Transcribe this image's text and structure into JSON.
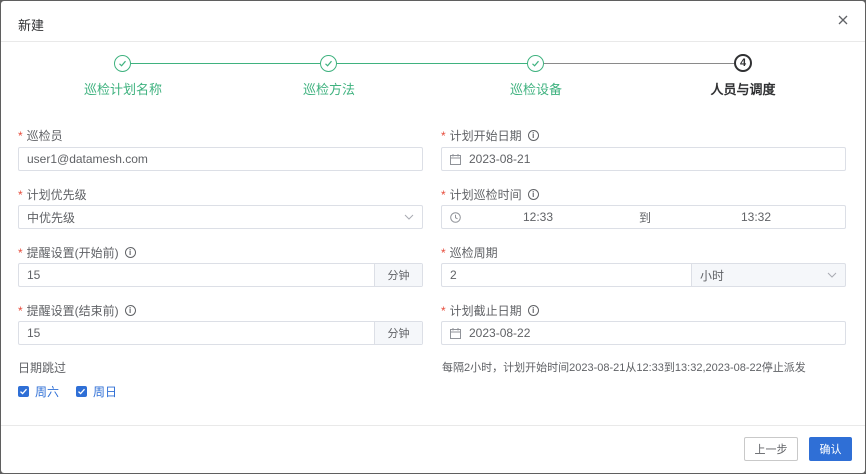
{
  "dialog": {
    "title": "新建"
  },
  "steps": [
    {
      "label": "巡检计划名称",
      "status": "done"
    },
    {
      "label": "巡检方法",
      "status": "done"
    },
    {
      "label": "巡检设备",
      "status": "done"
    },
    {
      "label": "人员与调度",
      "status": "active",
      "number": "4"
    }
  ],
  "form": {
    "inspector": {
      "label": "巡检员",
      "value": "user1@datamesh.com"
    },
    "start_date": {
      "label": "计划开始日期",
      "value": "2023-08-21"
    },
    "priority": {
      "label": "计划优先级",
      "value": "中优先级"
    },
    "time": {
      "label": "计划巡检时间",
      "start": "12:33",
      "sep": "到",
      "end": "13:32"
    },
    "remind_start": {
      "label": "提醒设置(开始前)",
      "value": "15",
      "unit": "分钟"
    },
    "period": {
      "label": "巡检周期",
      "value": "2",
      "unit": "小时"
    },
    "remind_end": {
      "label": "提醒设置(结束前)",
      "value": "15",
      "unit": "分钟"
    },
    "end_date": {
      "label": "计划截止日期",
      "value": "2023-08-22"
    },
    "skip": {
      "label": "日期跳过",
      "options": [
        "周六",
        "周日"
      ]
    },
    "summary": "每隔2小时，计划开始时间2023-08-21从12:33到13:32,2023-08-22停止派发"
  },
  "footer": {
    "prev_label": "上一步",
    "ok_label": "确认"
  },
  "colors": {
    "accent": "#2f6fd6",
    "done": "#3fb27f",
    "required": "#e74c3c"
  }
}
